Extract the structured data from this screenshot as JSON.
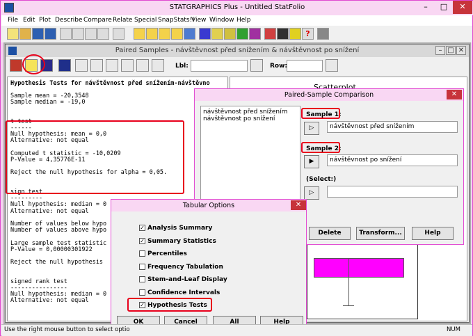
{
  "app": {
    "title": "STATGRAPHICS Plus - Untitled StatFolio",
    "window_controls": [
      "–",
      "□",
      "✕"
    ]
  },
  "menu": [
    "File",
    "Edit",
    "Plot",
    "Describe",
    "Compare",
    "Relate",
    "Special",
    "SnapStats!!",
    "View",
    "Window",
    "Help"
  ],
  "document": {
    "title": "Paired Samples - návštěvnost před snížením & návštěvnost po snížení",
    "lbl_label": "Lbl:",
    "row_label": "Row:"
  },
  "output_lines": [
    "Hypothesis Tests for návštěvnost před snížením-návštěvno",
    "",
    "Sample mean = -20,3548",
    "Sample median = -19,0",
    "",
    "",
    "t-test",
    "------",
    "Null hypothesis: mean = 0,0",
    "Alternative: not equal",
    "",
    "Computed t statistic = -10,0209",
    "P-Value = 4,35776E-11",
    "",
    "Reject the null hypothesis for alpha = 0,05.",
    "",
    "",
    "sign test",
    "---------",
    "Null hypothesis: median = 0",
    "Alternative: not equal",
    "",
    "Number of values below hypo",
    "Number of values above hypo",
    "",
    "Large sample test statistic",
    "P-Value = 0,00000301922",
    "",
    "Reject the null hypothesis",
    "",
    "",
    "signed rank test",
    "----------------",
    "Null hypothesis: median = 0",
    "Alternative: not equal"
  ],
  "right_pane": {
    "title": "Scatterplot"
  },
  "paired_dialog": {
    "title": "Paired-Sample Comparison",
    "variables": [
      "návštěvnost před snížením",
      "návštěvnost po snížení"
    ],
    "sample1_label": "Sample 1:",
    "sample1_value": "návštěvnost před snížením",
    "sample2_label": "Sample 2:",
    "sample2_value": "návštěvnost po snížení",
    "select_label": "(Select:)",
    "select_value": "",
    "buttons": [
      "Delete",
      "Transform...",
      "Help"
    ]
  },
  "tabular_dialog": {
    "title": "Tabular Options",
    "options": [
      {
        "label": "Analysis Summary",
        "checked": "✓"
      },
      {
        "label": "Summary Statistics",
        "checked": "✓"
      },
      {
        "label": "Percentiles",
        "checked": ""
      },
      {
        "label": "Frequency Tabulation",
        "checked": ""
      },
      {
        "label": "Stem-and-Leaf Display",
        "checked": ""
      },
      {
        "label": "Confidence Intervals",
        "checked": ""
      },
      {
        "label": "Hypothesis Tests",
        "checked": "✓"
      }
    ],
    "buttons": [
      "OK",
      "Cancel",
      "All",
      "Help"
    ]
  },
  "status": {
    "text": "Use the right mouse button to select optio",
    "num": "NUM"
  },
  "colors": {
    "highlight": "#e8001c",
    "box": "#ff00ff"
  }
}
